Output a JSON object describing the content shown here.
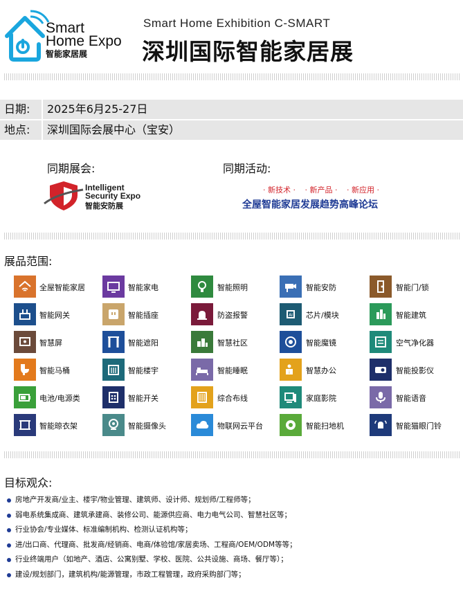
{
  "header": {
    "logo_line1": "Smart",
    "logo_line2": "Home Expo",
    "logo_line3": "智能家居展",
    "title_en": "Smart Home Exhibition C-SMART",
    "title_cn": "深圳国际智能家居展"
  },
  "info": {
    "date_label": "日期:",
    "date_value": "2025年6月25-27日",
    "venue_label": "地点:",
    "venue_value": "深圳国际会展中心（宝安）"
  },
  "concurrent": {
    "exhibition_title": "同期展会:",
    "ise_line1": "Intelligent",
    "ise_line2": "Security Expo",
    "ise_line3": "智能安防展",
    "activity_title": "同期活动:",
    "activity_tags": [
      "· 新技术 ·",
      "· 新产品 ·",
      "· 新应用 ·"
    ],
    "activity_name": "全屋智能家居发展趋势高峰论坛"
  },
  "products": {
    "title": "展品范围:",
    "items": [
      {
        "label": "全屋智能家居",
        "color": "#d9732c",
        "icon": "house-wifi-icon"
      },
      {
        "label": "智能家电",
        "color": "#6b3aa0",
        "icon": "tv-icon"
      },
      {
        "label": "智能照明",
        "color": "#2f8a3f",
        "icon": "bulb-icon"
      },
      {
        "label": "智能安防",
        "color": "#3a6fb5",
        "icon": "camera-icon"
      },
      {
        "label": "智能门/锁",
        "color": "#8b5a2b",
        "icon": "door-lock-icon"
      },
      {
        "label": "智能网关",
        "color": "#1d4f8c",
        "icon": "gateway-icon"
      },
      {
        "label": "智能插座",
        "color": "#c9a56b",
        "icon": "socket-icon"
      },
      {
        "label": "防盗报警",
        "color": "#7a1a3a",
        "icon": "alarm-icon"
      },
      {
        "label": "芯片/模块",
        "color": "#1d5b73",
        "icon": "chip-icon"
      },
      {
        "label": "智能建筑",
        "color": "#2b9a5a",
        "icon": "building-icon"
      },
      {
        "label": "智慧屏",
        "color": "#6b4a3a",
        "icon": "screen-icon"
      },
      {
        "label": "智能遮阳",
        "color": "#1e4f9a",
        "icon": "curtain-icon"
      },
      {
        "label": "智慧社区",
        "color": "#3a7a3a",
        "icon": "community-icon"
      },
      {
        "label": "智能魔镜",
        "color": "#1e4f9a",
        "icon": "mirror-icon"
      },
      {
        "label": "空气净化器",
        "color": "#1f8a7a",
        "icon": "air-purifier-icon"
      },
      {
        "label": "智能马桶",
        "color": "#e37a1c",
        "icon": "toilet-icon"
      },
      {
        "label": "智能楼宇",
        "color": "#1d6a7a",
        "icon": "tower-icon"
      },
      {
        "label": "智能睡眠",
        "color": "#7a6aa8",
        "icon": "bed-icon"
      },
      {
        "label": "智慧办公",
        "color": "#e3a21c",
        "icon": "office-icon"
      },
      {
        "label": "智能投影仪",
        "color": "#1e2f6a",
        "icon": "projector-icon"
      },
      {
        "label": "电池/电源类",
        "color": "#3aa03a",
        "icon": "battery-icon"
      },
      {
        "label": "智能开关",
        "color": "#1e2f6a",
        "icon": "switch-icon"
      },
      {
        "label": "综合布线",
        "color": "#e3a21c",
        "icon": "cabling-icon"
      },
      {
        "label": "家庭影院",
        "color": "#1f8a7a",
        "icon": "cinema-icon"
      },
      {
        "label": "智能语音",
        "color": "#7a6aa8",
        "icon": "microphone-icon"
      },
      {
        "label": "智能晾衣架",
        "color": "#2a3a7a",
        "icon": "clothes-rack-icon"
      },
      {
        "label": "智能摄像头",
        "color": "#4a8a8a",
        "icon": "webcam-icon"
      },
      {
        "label": "物联网云平台",
        "color": "#2a8ad8",
        "icon": "cloud-icon"
      },
      {
        "label": "智能扫地机",
        "color": "#5aaa3a",
        "icon": "robot-vacuum-icon"
      },
      {
        "label": "智能猫眼门铃",
        "color": "#1e3a7a",
        "icon": "doorbell-icon"
      }
    ]
  },
  "audience": {
    "title": "目标观众:",
    "items": [
      "房地产开发商/业主、楼宇/物业管理、建筑师、设计师、规划师/工程师等；",
      "弱电系统集成商、建筑承建商、装修公司、能源供应商、电力电气公司、智慧社区等；",
      "行业协会/专业媒体、标准编制机构、检测认证机构等；",
      "进/出口商、代理商、批发商/经销商、电商/体验馆/家居卖场、工程商/OEM/ODM等等；",
      "行业终端用户（如地产、酒店、公寓别墅、学校、医院、公共设施、商场、餐厅等）；",
      "建设/规划部门，建筑机构/能源管理，市政工程管理，政府采购部门等；"
    ]
  }
}
